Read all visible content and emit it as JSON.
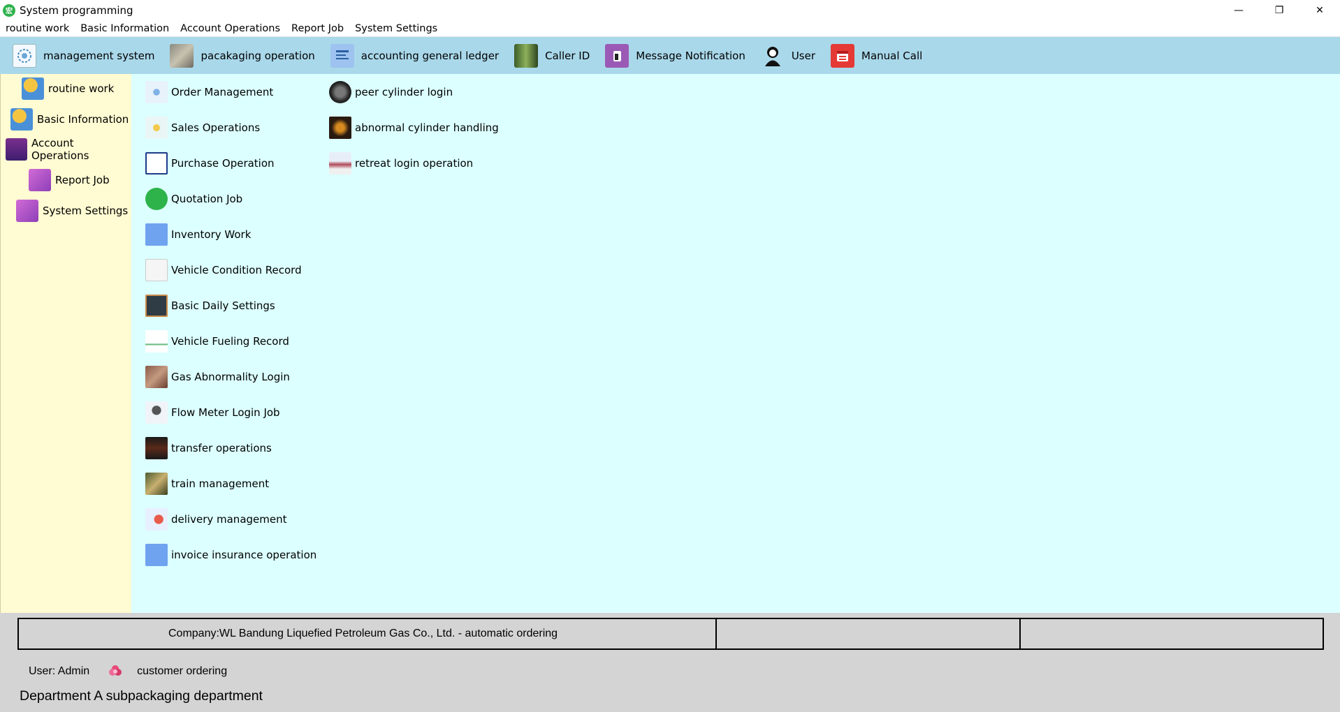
{
  "window": {
    "title": "System programming",
    "app_icon_text": "宏",
    "controls": [
      "—",
      "❐",
      "✕"
    ]
  },
  "menu": [
    "routine work",
    "Basic Information",
    "Account Operations",
    "Report Job",
    "System Settings"
  ],
  "toolbar": [
    {
      "label": "management system",
      "icon": "gear-globe-icon"
    },
    {
      "label": "pacakaging operation",
      "icon": "factory-icon"
    },
    {
      "label": "accounting general ledger",
      "icon": "ledger-icon"
    },
    {
      "label": "Caller ID",
      "icon": "phone-icon"
    },
    {
      "label": "Message Notification",
      "icon": "message-icon"
    },
    {
      "label": "User",
      "icon": "user-icon"
    },
    {
      "label": "Manual Call",
      "icon": "calendar-icon"
    }
  ],
  "left_nav": [
    {
      "label": "routine work",
      "icon": "worker-icon"
    },
    {
      "label": "Basic Information",
      "icon": "info-worker-icon"
    },
    {
      "label": "Account Operations",
      "icon": "account-chart-icon"
    },
    {
      "label": "Report Job",
      "icon": "report-icon"
    },
    {
      "label": "System Settings",
      "icon": "settings-doc-icon"
    }
  ],
  "content_col1": [
    {
      "label": "Order Management",
      "icon": "network-icon"
    },
    {
      "label": "Sales Operations",
      "icon": "sales-icon"
    },
    {
      "label": "Purchase Operation",
      "icon": "purchase-grid-icon"
    },
    {
      "label": "Quotation Job",
      "icon": "quotation-icon"
    },
    {
      "label": "Inventory Work",
      "icon": "inventory-icon"
    },
    {
      "label": "Vehicle Condition Record",
      "icon": "vehicle-record-icon"
    },
    {
      "label": "Basic Daily Settings",
      "icon": "chalkboard-icon"
    },
    {
      "label": "Vehicle Fueling Record",
      "icon": "fuel-chart-icon"
    },
    {
      "label": "Gas Abnormality Login",
      "icon": "gas-photo-icon"
    },
    {
      "label": "Flow Meter Login Job",
      "icon": "flow-meter-icon"
    },
    {
      "label": "transfer operations",
      "icon": "transfer-icon"
    },
    {
      "label": "train management",
      "icon": "train-icon"
    },
    {
      "label": "delivery management",
      "icon": "delivery-icon"
    },
    {
      "label": "invoice insurance operation",
      "icon": "invoice-icon"
    }
  ],
  "content_col2": [
    {
      "label": "peer cylinder login",
      "icon": "cylinder-icon"
    },
    {
      "label": "abnormal cylinder handling",
      "icon": "abnormal-cylinder-icon"
    },
    {
      "label": "retreat login operation",
      "icon": "retreat-icon"
    }
  ],
  "status": {
    "company": "Company:WL Bandung Liquefied Petroleum Gas Co., Ltd. - automatic ordering",
    "panel2": "",
    "panel3": "",
    "user": "User: Admin",
    "mode": "customer ordering",
    "department": "Department A subpackaging department"
  },
  "colors": {
    "toolbar_bg": "#a9d8ea",
    "leftnav_bg": "#fffbd2",
    "content_bg": "#dcffff",
    "status_bg": "#d4d4d4"
  }
}
